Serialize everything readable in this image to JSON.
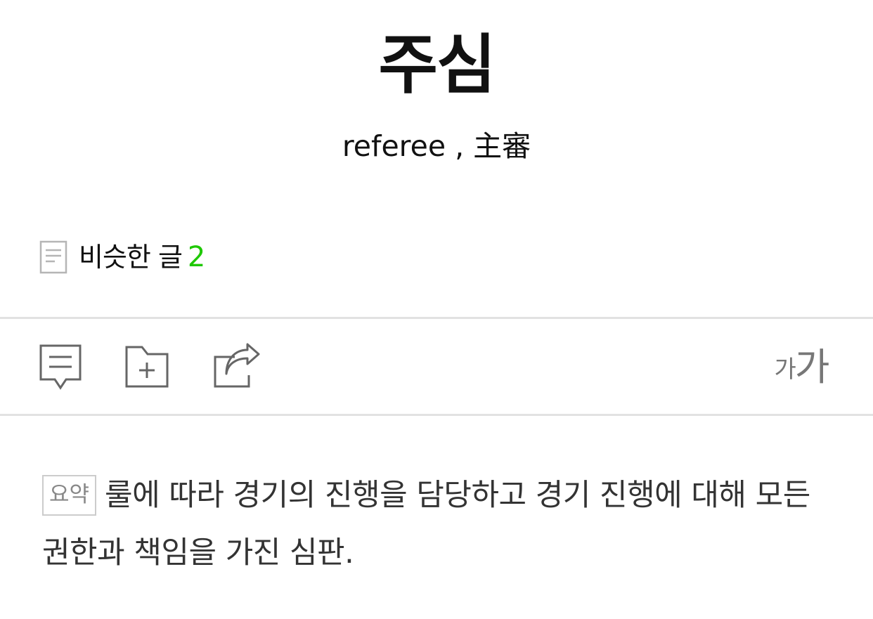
{
  "entry": {
    "title": "주심",
    "subtitle": "referee , 主審"
  },
  "similar": {
    "icon": "document-icon",
    "label": "비슷한 글",
    "count": "2",
    "count_color": "#1ec800"
  },
  "toolbar": {
    "comment_icon": "comment-icon",
    "save_icon": "folder-add-icon",
    "share_icon": "share-icon",
    "font_size_small": "가",
    "font_size_large": "가"
  },
  "summary": {
    "badge": "요약",
    "text": "룰에 따라 경기의 진행을 담당하고 경기 진행에 대해 모든 권한과 책임을 가진 심판."
  },
  "colors": {
    "accent": "#1ec800",
    "divider": "#e2e2e2",
    "icon": "#666666"
  }
}
